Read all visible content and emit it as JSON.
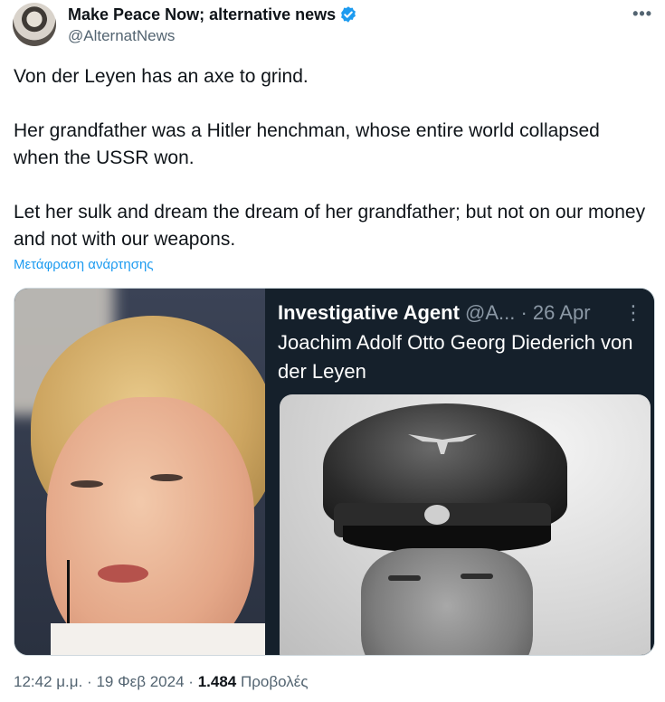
{
  "author": {
    "display_name": "Make Peace Now; alternative news",
    "handle": "@AlternatNews",
    "verified": true,
    "verified_icon": "verified-badge-icon",
    "avatar_icon": "avatar"
  },
  "more_icon": "more-options-icon",
  "more_glyph": "•••",
  "tweet": {
    "paragraphs": [
      "Von der Leyen has an axe to grind.",
      "Her grandfather was a Hitler henchman, whose entire world collapsed when the USSR won.",
      "Let her sulk and dream the dream of her grandfather; but not on our money and not with our weapons."
    ],
    "translate_label": "Μετάφραση ανάρτησης"
  },
  "media": {
    "quoted_author": "Investigative Agent",
    "quoted_meta": "@A... · 26 Apr",
    "quoted_dots": "⋮",
    "quoted_text": "Joachim Adolf Otto Georg Diederich von der Leyen"
  },
  "footer": {
    "time": "12:42 μ.μ.",
    "separator": "·",
    "date": "19 Φεβ 2024",
    "views_count": "1.484",
    "views_label": "Προβολές"
  },
  "colors": {
    "accent": "#1d9bf0",
    "secondary_text": "#536471",
    "dark_panel": "#15202b"
  }
}
